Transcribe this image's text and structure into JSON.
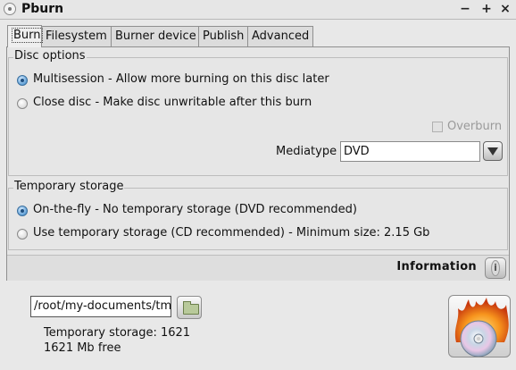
{
  "window": {
    "title": "Pburn"
  },
  "tabs": [
    {
      "label": "Burn"
    },
    {
      "label": "Filesystem"
    },
    {
      "label": "Burner device"
    },
    {
      "label": "Publish"
    },
    {
      "label": "Advanced"
    }
  ],
  "disc_options": {
    "title": "Disc options",
    "multisession": "Multisession - Allow more burning on this disc later",
    "close_disc": "Close disc - Make disc unwritable after this burn",
    "overburn": "Overburn",
    "mediatype_label": "Mediatype",
    "mediatype_value": "DVD"
  },
  "temp_storage": {
    "title": "Temporary storage",
    "on_the_fly": "On-the-fly - No temporary storage (DVD recommended)",
    "use_temp": "Use temporary storage (CD recommended) - Minimum size: 2.15 Gb"
  },
  "information": {
    "label": "Information",
    "icon": "info-icon"
  },
  "path": {
    "value": "/root/my-documents/tmp"
  },
  "status": {
    "temp_storage": "Temporary storage: 1621",
    "free": "1621 Mb free"
  },
  "colors": {
    "radio_selected": "#5e9fd6",
    "flame": "#f07a14"
  }
}
